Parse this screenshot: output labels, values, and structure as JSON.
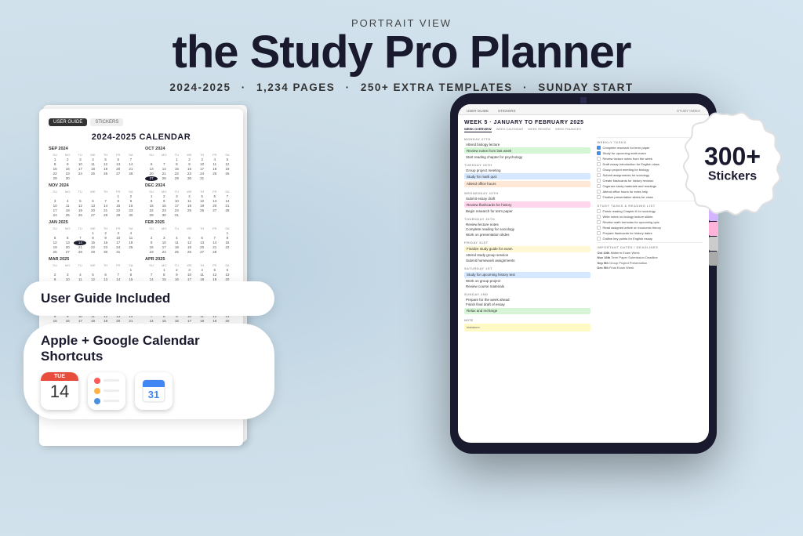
{
  "header": {
    "portrait_label": "PORTRAIT VIEW",
    "main_title": "the Study Pro Planner",
    "subtitle": {
      "year": "2024-2025",
      "pages": "1,234 PAGES",
      "templates": "250+ EXTRA TEMPLATES",
      "start": "SUNDAY START",
      "dot": "·"
    }
  },
  "features": {
    "user_guide": "User Guide Included",
    "shortcuts": "Apple + Google Calendar Shortcuts"
  },
  "sticker_badge": {
    "count": "300+",
    "label": "Stickers"
  },
  "tablet": {
    "week_header": "WEEK 5 · JANUARY TO FEBRUARY 2025",
    "tabs": {
      "user_guide": "USER GUIDE",
      "stickers": "STICKERS",
      "study_index": "STUDY INDEX"
    },
    "week_nav": [
      "WEEK OVERVIEW",
      "WEEK CALENDAR",
      "WEEK REVIEW",
      "WEEK FINANCES"
    ],
    "days": [
      {
        "label": "MONDAY 27TH",
        "tasks": [
          "Attend biology lecture",
          "Review notes from last week",
          "Start reading chapter for psychology"
        ],
        "highlights": []
      },
      {
        "label": "TUESDAY 28TH",
        "tasks": [
          "Group project meeting"
        ],
        "highlights": [
          "Study for math quiz",
          "Attend office hours"
        ]
      },
      {
        "label": "WEDNESDAY 29TH",
        "tasks": [
          "Submit essay draft"
        ],
        "highlights": [
          "Review flashcards for history",
          "Begin research for term paper"
        ]
      },
      {
        "label": "THURSDAY 30TH",
        "tasks": [
          "Review lecture notes",
          "Complete reading for sociology",
          "Work on presentation slides"
        ],
        "highlights": []
      },
      {
        "label": "FRIDAY 31ST",
        "tasks": [],
        "highlights": [
          "Finalize study guide for exam",
          "Attend study group session",
          "Submit homework assignments"
        ]
      },
      {
        "label": "SATURDAY 1ST",
        "tasks": [],
        "highlights": [
          "Study for upcoming history test",
          "Work on group project",
          "Review course materials"
        ]
      },
      {
        "label": "SUNDAY 2ND",
        "tasks": [
          "Prepare for the week ahead",
          "Finish final draft of essay"
        ],
        "highlights": [
          "Relax and recharge"
        ]
      }
    ],
    "weekly_tasks": {
      "title": "WEEKLY TASKS",
      "items": [
        {
          "text": "Complete research for term paper",
          "checked": true
        },
        {
          "text": "Study for upcoming math exam",
          "checked": true
        },
        {
          "text": "Review lecture notes from the week",
          "checked": false
        },
        {
          "text": "Draft essay introduction for English class",
          "checked": false
        },
        {
          "text": "Group project meeting for biology",
          "checked": false
        },
        {
          "text": "Submit assignments for sociology",
          "checked": false
        },
        {
          "text": "Create flashcards for history revision",
          "checked": false
        },
        {
          "text": "Organize study materials and readings",
          "checked": false
        },
        {
          "text": "Attend office hours for extra help",
          "checked": false
        },
        {
          "text": "Finalize presentation slides for class",
          "checked": false
        }
      ]
    },
    "study_tasks": {
      "title": "STUDY TASKS & READING LIST",
      "items": [
        {
          "text": "Finish reading Chapter 6 for sociology",
          "checked": false
        },
        {
          "text": "Write notes on biology lecture slides",
          "checked": false
        },
        {
          "text": "Review math formulas for upcoming quiz",
          "checked": false
        },
        {
          "text": "Read assigned article on economic theory",
          "checked": false
        },
        {
          "text": "Prepare flashcards for history dates",
          "checked": false
        },
        {
          "text": "Outline key points for English essay",
          "checked": false
        }
      ]
    },
    "important_dates": {
      "title": "IMPORTANT DATES / DEADLINES",
      "items": [
        {
          "date": "Oct 10th",
          "text": "Midterm Exam Week"
        },
        {
          "date": "Nov 16th",
          "text": "Term Paper Submission Deadline"
        },
        {
          "date": "Sep 9th",
          "text": "Group Project Presentation"
        },
        {
          "date": "Dec 5th",
          "text": "Final Exam Week"
        }
      ]
    }
  },
  "calendar_page": {
    "title": "2024-2025 CALENDAR",
    "tabs": [
      "USER GUIDE",
      "STICKERS"
    ]
  },
  "apple_cal": {
    "day": "TUE",
    "date": "14"
  },
  "side_tabs_colors": [
    "#ff9999",
    "#ffb366",
    "#ffff99",
    "#99ff99",
    "#99ccff",
    "#cc99ff",
    "#ff99cc",
    "#aaaaaa"
  ]
}
